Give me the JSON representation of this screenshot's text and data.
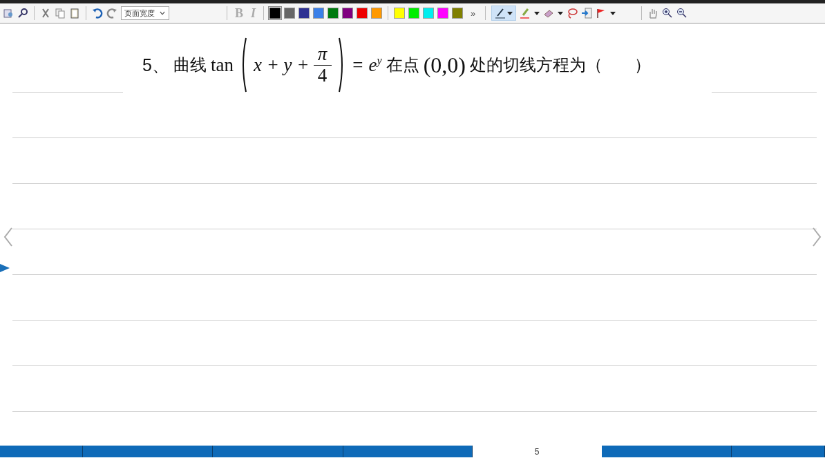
{
  "toolbar": {
    "zoom_select": "页面宽度",
    "bold_label": "B",
    "italic_label": "I",
    "colors": [
      {
        "color": "#000000",
        "selected": true
      },
      {
        "color": "#666666",
        "selected": false
      },
      {
        "color": "#2e3192",
        "selected": false
      },
      {
        "color": "#3a7fe8",
        "selected": false
      },
      {
        "color": "#007a10",
        "selected": false
      },
      {
        "color": "#800080",
        "selected": false
      },
      {
        "color": "#ee0000",
        "selected": false
      },
      {
        "color": "#ff9900",
        "selected": false
      },
      {
        "color": "#ffff00",
        "selected": false
      },
      {
        "color": "#00ee00",
        "selected": false
      },
      {
        "color": "#00eeee",
        "selected": false
      },
      {
        "color": "#ff00ff",
        "selected": false
      },
      {
        "color": "#808000",
        "selected": false
      }
    ],
    "more": "»",
    "pen_selected": true
  },
  "question": {
    "number": "5、",
    "lead": "曲线",
    "func": "tan",
    "terms": "x + y +",
    "frac_num": "π",
    "frac_den": "4",
    "equals": "= e",
    "exponent": "y",
    "at_point": "在点",
    "point": "(0,0)",
    "tail": "处的切线方程为（",
    "close": "）"
  },
  "footer": {
    "page": "5"
  }
}
